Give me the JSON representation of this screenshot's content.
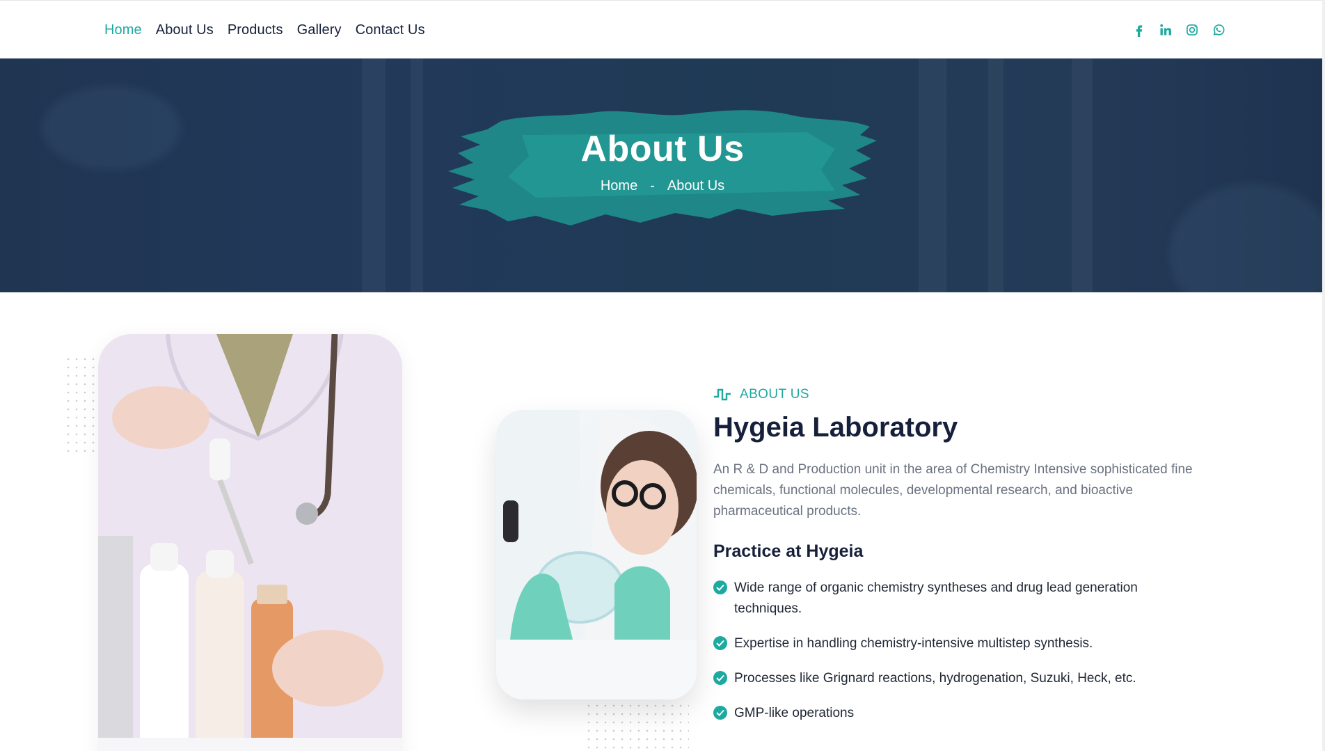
{
  "nav": {
    "items": [
      {
        "label": "Home",
        "active": true
      },
      {
        "label": "About Us",
        "active": false
      },
      {
        "label": "Products",
        "active": false
      },
      {
        "label": "Gallery",
        "active": false
      },
      {
        "label": "Contact Us",
        "active": false
      }
    ],
    "social": [
      "facebook-icon",
      "linkedin-icon",
      "instagram-icon",
      "whatsapp-icon"
    ]
  },
  "banner": {
    "title": "About Us",
    "breadcrumb": {
      "home": "Home",
      "separator": "-",
      "current": "About Us"
    }
  },
  "about": {
    "tag": "ABOUT US",
    "heading": "Hygeia Laboratory",
    "description": "An R & D and Production unit in the area of Chemistry Intensive sophisticated fine chemicals, functional molecules, developmental research, and bioactive pharmaceutical products.",
    "subheading": "Practice at Hygeia",
    "practices": [
      "Wide range of organic chemistry syntheses and drug lead generation techniques.",
      "Expertise in handling chemistry-intensive multistep synthesis.",
      "Processes like Grignard reactions, hydrogenation, Suzuki, Heck, etc.",
      "GMP-like operations"
    ]
  },
  "colors": {
    "accent": "#1ca9a0",
    "navy": "#1f3552",
    "text": "#16203a",
    "muted": "#6b7280"
  }
}
